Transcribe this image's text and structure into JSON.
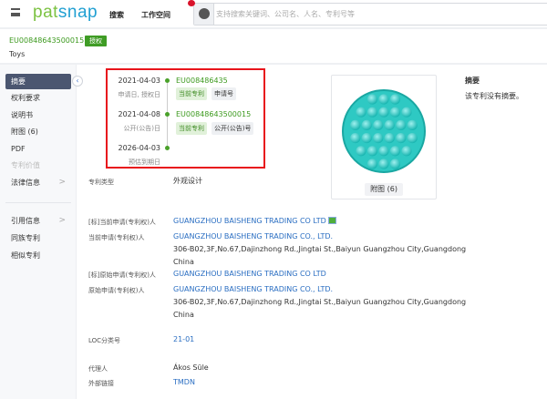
{
  "header": {
    "logo_left": "pat",
    "logo_right": "snap",
    "nav": [
      "搜索",
      "工作空间"
    ],
    "search_placeholder": "支持搜索关键词、公司名、人名、专利号等"
  },
  "patent": {
    "number": "EU00848643500015",
    "status_badge": "授权",
    "title": "Toys"
  },
  "sidebar": {
    "items": [
      {
        "label": "摘要",
        "state": "active"
      },
      {
        "label": "权利要求"
      },
      {
        "label": "说明书"
      },
      {
        "label": "附图 (6)"
      },
      {
        "label": "PDF"
      },
      {
        "label": "专利价值",
        "state": "disabled"
      },
      {
        "label": "法律信息",
        "chevron": true
      }
    ],
    "items2": [
      {
        "label": "引用信息",
        "chevron": true
      },
      {
        "label": "同族专利"
      },
      {
        "label": "相似专利"
      }
    ],
    "chevron": ">",
    "collapse": "‹"
  },
  "timeline": [
    {
      "date": "2021-04-03",
      "label": "申请日, 授权日",
      "number": "EU008486435",
      "tags": [
        "当前专利",
        "申请号"
      ]
    },
    {
      "date": "2021-04-08",
      "label": "公开(公告)日",
      "number": "EU00848643500015",
      "tags": [
        "当前专利",
        "公开(公告)号"
      ]
    },
    {
      "date": "2026-04-03",
      "label": "预估到期日"
    }
  ],
  "figure": {
    "button": "附图 (6)"
  },
  "abstract": {
    "heading": "摘要",
    "text": "该专利没有摘要。"
  },
  "fields": {
    "type": {
      "label": "专利类型",
      "value": "外观设计"
    },
    "std_current": {
      "label": "[标]当前申请(专利权)人",
      "value": "GUANGZHOU BAISHENG TRADING CO LTD"
    },
    "current": {
      "label": "当前申请(专利权)人",
      "value": "GUANGZHOU BAISHENG TRADING CO., LTD.",
      "address": "306-B02,3F,No.67,Dajinzhong Rd.,Jingtai St.,Baiyun Guangzhou City,Guangdong",
      "country": "China"
    },
    "std_original": {
      "label": "[标]原始申请(专利权)人",
      "value": "GUANGZHOU BAISHENG TRADING CO LTD"
    },
    "original": {
      "label": "原始申请(专利权)人",
      "value": "GUANGZHOU BAISHENG TRADING CO., LTD.",
      "address": "306-B02,3F,No.67,Dajinzhong Rd.,Jingtai St.,Baiyun Guangzhou City,Guangdong",
      "country": "China"
    },
    "loc": {
      "label": "LOC分类号",
      "value": "21-01"
    },
    "agent": {
      "label": "代理人",
      "value": "Ákos Süle"
    },
    "external": {
      "label": "外部链接",
      "value": "TMDN"
    }
  }
}
